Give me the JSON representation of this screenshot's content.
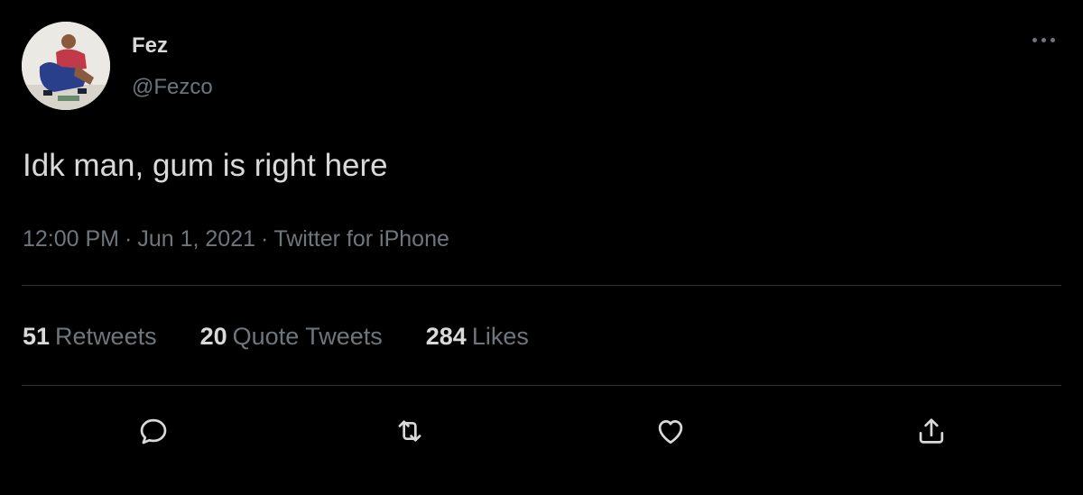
{
  "tweet": {
    "author": {
      "display_name": "Fez",
      "handle": "@Fezco"
    },
    "text": "Idk man, gum is right here",
    "meta": {
      "time": "12:00 PM",
      "date": "Jun 1, 2021",
      "source": "Twitter for iPhone",
      "separator": "·"
    },
    "stats": {
      "retweets": {
        "count": "51",
        "label": "Retweets"
      },
      "quote_tweets": {
        "count": "20",
        "label": "Quote Tweets"
      },
      "likes": {
        "count": "284",
        "label": "Likes"
      }
    },
    "actions": [
      "reply-icon",
      "retweet-icon",
      "like-icon",
      "share-icon"
    ]
  },
  "colors": {
    "background": "#000000",
    "primary_text": "#d9d9d9",
    "secondary_text": "#6e767d",
    "divider": "#2f3336"
  }
}
